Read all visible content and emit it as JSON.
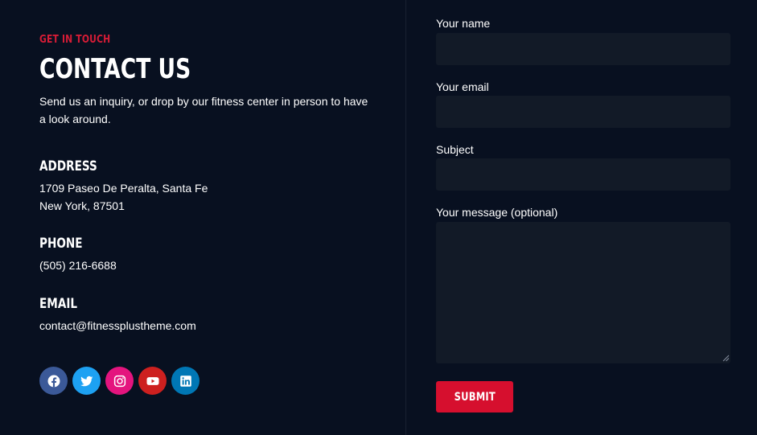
{
  "contact": {
    "eyebrow": "GET IN TOUCH",
    "title": "CONTACT US",
    "intro": "Send us an inquiry, or drop by our fitness center in person to have a look around.",
    "address": {
      "heading": "ADDRESS",
      "line1": "1709 Paseo De Peralta, Santa Fe",
      "line2": "New York, 87501"
    },
    "phone": {
      "heading": "PHONE",
      "value": "(505) 216-6688"
    },
    "email": {
      "heading": "EMAIL",
      "value": "contact@fitnessplustheme.com"
    },
    "social": [
      {
        "icon": "facebook-icon",
        "color": "#3b5998"
      },
      {
        "icon": "twitter-icon",
        "color": "#1da1f2"
      },
      {
        "icon": "instagram-icon",
        "color": "#e4147e"
      },
      {
        "icon": "youtube-icon",
        "color": "#cd201f"
      },
      {
        "icon": "linkedin-icon",
        "color": "#0077b5"
      }
    ]
  },
  "form": {
    "name_label": "Your name",
    "name_value": "",
    "email_label": "Your email",
    "email_value": "",
    "subject_label": "Subject",
    "subject_value": "",
    "message_label": "Your message (optional)",
    "message_value": "",
    "submit_label": "SUBMIT"
  },
  "colors": {
    "background": "#081020",
    "field_background": "#121a27",
    "accent": "#d60f2e"
  }
}
